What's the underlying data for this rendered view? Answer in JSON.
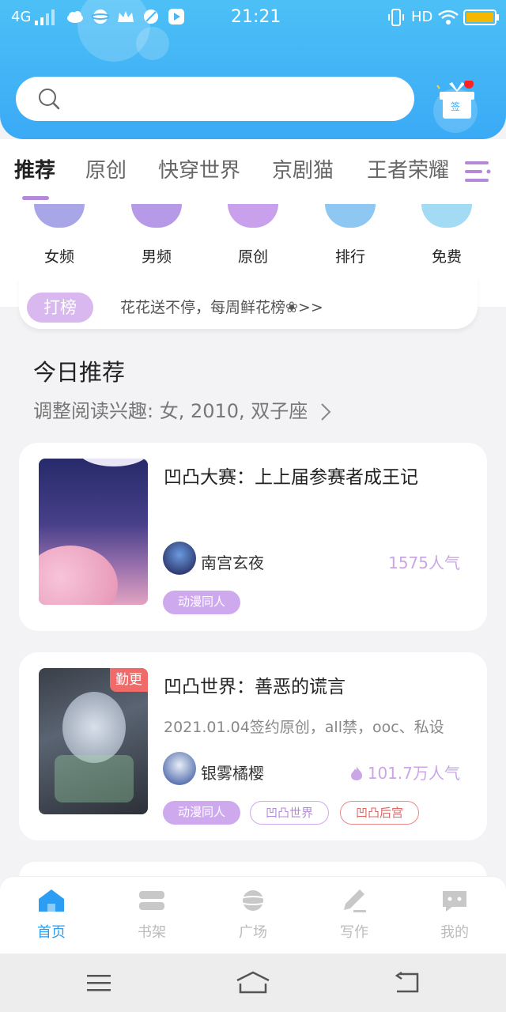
{
  "status_bar": {
    "network": "4G",
    "time": "21:21",
    "hd": "HD"
  },
  "search": {
    "placeholder": ""
  },
  "gift": {
    "label": "签"
  },
  "tabs": [
    {
      "label": "推荐",
      "active": true
    },
    {
      "label": "原创"
    },
    {
      "label": "快穿世界"
    },
    {
      "label": "京剧猫"
    },
    {
      "label": "王者荣耀"
    }
  ],
  "categories": [
    {
      "label": "女频",
      "color": "#a9a6e8"
    },
    {
      "label": "男频",
      "color": "#b69ae8"
    },
    {
      "label": "原创",
      "color": "#c9a0ec"
    },
    {
      "label": "排行",
      "color": "#8fc7f3"
    },
    {
      "label": "免费",
      "color": "#a3dbf5"
    }
  ],
  "ranking": {
    "badge": "打榜",
    "text": "花花送不停，每周鲜花榜❀>>"
  },
  "section": {
    "title": "今日推荐",
    "subtitle": "调整阅读兴趣: 女, 2010, 双子座"
  },
  "books": [
    {
      "title": "凹凸大赛：上上届参赛者成王记",
      "author": "南宫玄夜",
      "popularity": "1575人气",
      "tags": [
        "动漫同人"
      ]
    },
    {
      "ribbon": "勤更",
      "title": "凹凸世界：善恶的谎言",
      "description": "2021.01.04签约原创，all禁，ooc、私设",
      "author": "银雾橘樱",
      "popularity": "101.7万人气",
      "tags": [
        "动漫同人",
        "凹凸世界",
        "凹凸后宫"
      ]
    }
  ],
  "bottom_nav": [
    {
      "label": "首页",
      "active": true
    },
    {
      "label": "书架"
    },
    {
      "label": "广场"
    },
    {
      "label": "写作"
    },
    {
      "label": "我的"
    }
  ],
  "colors": {
    "header": "#3aaaf6",
    "accent": "#2b9df3",
    "tag_purple": "#cfa9ee",
    "ribbon_red": "#f06a6a"
  }
}
